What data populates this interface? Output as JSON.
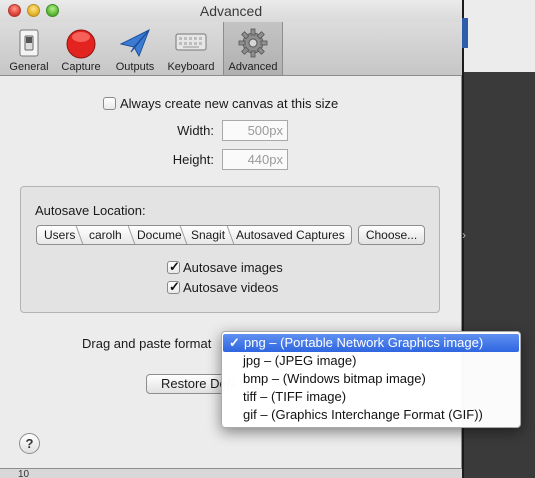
{
  "window": {
    "title": "Advanced"
  },
  "toolbar": {
    "tabs": [
      {
        "label": "General",
        "icon": "switch-icon"
      },
      {
        "label": "Capture",
        "icon": "record-icon"
      },
      {
        "label": "Outputs",
        "icon": "paper-plane-icon"
      },
      {
        "label": "Keyboard",
        "icon": "keyboard-icon"
      },
      {
        "label": "Advanced",
        "icon": "gear-icon"
      }
    ],
    "selected": "Advanced"
  },
  "canvas": {
    "always_create_label": "Always create new canvas at this size",
    "always_create_checked": false,
    "width_label": "Width:",
    "width_value": "500px",
    "height_label": "Height:",
    "height_value": "440px"
  },
  "autosave": {
    "location_label": "Autosave Location:",
    "path": [
      "Users",
      "carolh",
      "Docume",
      "Snagit",
      "Autosaved Captures"
    ],
    "choose_label": "Choose...",
    "images_label": "Autosave images",
    "images_checked": true,
    "videos_label": "Autosave videos",
    "videos_checked": true
  },
  "drag_paste": {
    "label": "Drag and paste format",
    "options": [
      "png – (Portable Network Graphics image)",
      "jpg – (JPEG image)",
      "bmp – (Windows bitmap image)",
      "tiff – (TIFF image)",
      "gif – (Graphics Interchange Format (GIF))"
    ],
    "selected_index": 0,
    "check": "✓"
  },
  "restore_label": "Restore Defaults",
  "help_label": "?",
  "bottom_ruler_text": "10"
}
